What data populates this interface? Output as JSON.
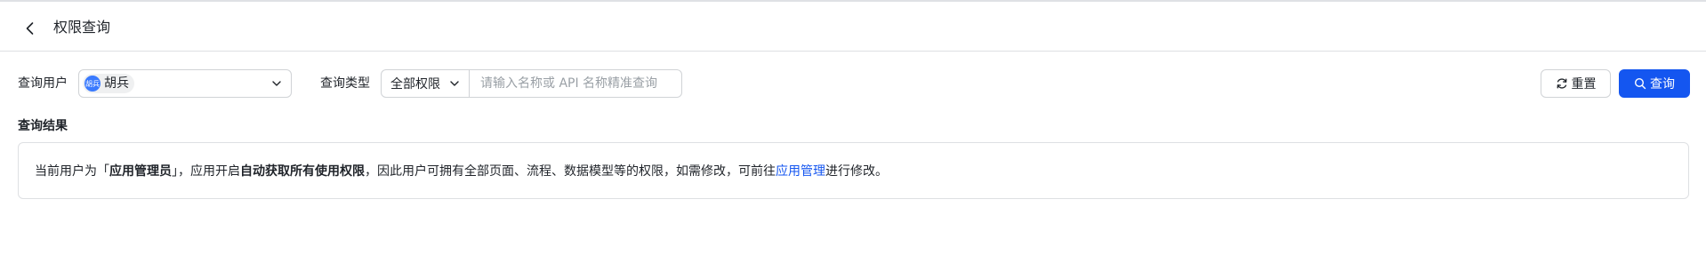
{
  "header": {
    "title": "权限查询"
  },
  "filters": {
    "user_label": "查询用户",
    "user": {
      "avatar_text": "胡兵",
      "name": "胡兵"
    },
    "type_label": "查询类型",
    "type_value": "全部权限",
    "search_placeholder": "请输入名称或 API 名称精准查询"
  },
  "buttons": {
    "reset_label": "重置",
    "query_label": "查询"
  },
  "colors": {
    "primary": "#1456f0",
    "avatar": "#3a7afe",
    "border": "#d0d3d6"
  },
  "results": {
    "heading": "查询结果",
    "message": {
      "part1": "当前用户为「",
      "role": "应用管理员",
      "part2": "」，应用开启",
      "feature": "自动获取所有使用权限",
      "part3": "，因此用户可拥有全部页面、流程、数据模型等的权限，如需修改，可前往",
      "link": "应用管理",
      "part4": "进行修改。"
    }
  }
}
